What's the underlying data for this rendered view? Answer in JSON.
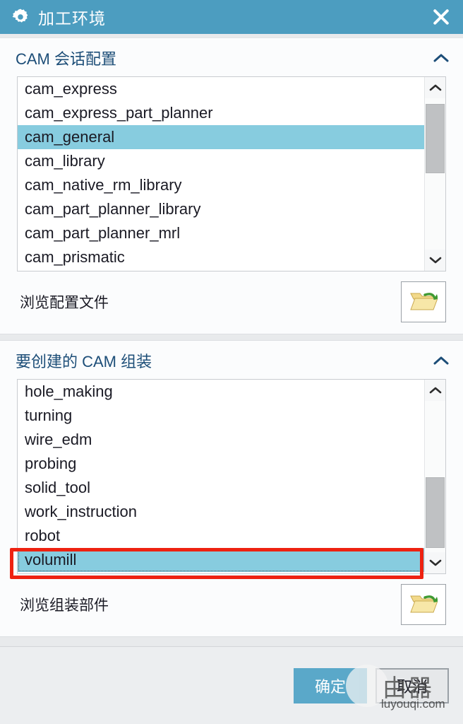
{
  "window": {
    "title": "加工环境",
    "gear_icon": "gear-icon",
    "close_icon": "close-icon"
  },
  "sections": [
    {
      "title": "CAM 会话配置",
      "collapse_icon": "chevron-up-icon",
      "items": [
        "cam_express",
        "cam_express_part_planner",
        "cam_general",
        "cam_library",
        "cam_native_rm_library",
        "cam_part_planner_library",
        "cam_part_planner_mrl",
        "cam_prismatic"
      ],
      "selected_index": 2,
      "browse_label": "浏览配置文件",
      "browse_icon": "open-folder-icon"
    },
    {
      "title": "要创建的 CAM 组装",
      "collapse_icon": "chevron-up-icon",
      "items": [
        "hole_making",
        "turning",
        "wire_edm",
        "probing",
        "solid_tool",
        "work_instruction",
        "robot",
        "volumill"
      ],
      "selected_index": 7,
      "browse_label": "浏览组装部件",
      "browse_icon": "open-folder-icon"
    }
  ],
  "footer": {
    "ok_label": "确定",
    "cancel_label": "取消"
  },
  "watermark": {
    "glyphs": "由器",
    "url": "luyouqi.com"
  },
  "colors": {
    "titlebar": "#4c9dc0",
    "section_title": "#1d4e78",
    "selection": "#87ccdf",
    "ok_button": "#5aa8c9",
    "annotation": "#ee2211",
    "scroll_thumb": "#bfc1c3"
  }
}
